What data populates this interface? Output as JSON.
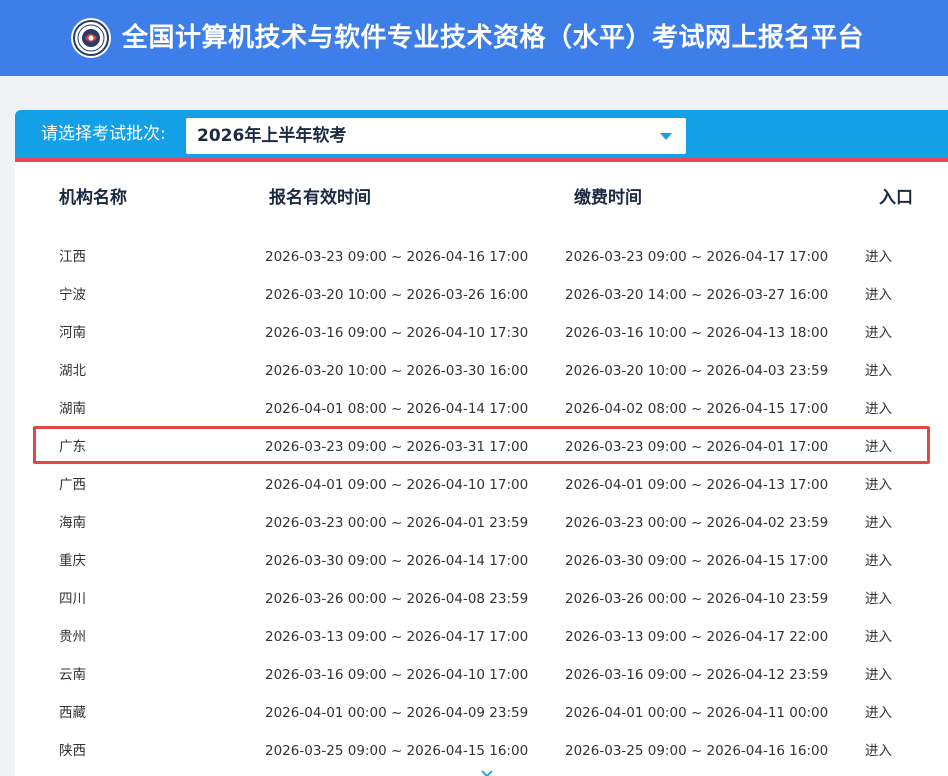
{
  "header": {
    "title": "全国计算机技术与软件专业技术资格（水平）考试网上报名平台"
  },
  "batch": {
    "label": "请选择考试批次:",
    "selected": "2026年上半年软考"
  },
  "table": {
    "columns": [
      "机构名称",
      "报名有效时间",
      "缴费时间",
      "入口"
    ],
    "rows": [
      {
        "name": "江西",
        "reg": "2026-03-23 09:00 ~ 2026-04-16 17:00",
        "pay": "2026-03-23 09:00 ~ 2026-04-17 17:00",
        "entry": "进入"
      },
      {
        "name": "宁波",
        "reg": "2026-03-20 10:00 ~ 2026-03-26 16:00",
        "pay": "2026-03-20 14:00 ~ 2026-03-27 16:00",
        "entry": "进入"
      },
      {
        "name": "河南",
        "reg": "2026-03-16 09:00 ~ 2026-04-10 17:30",
        "pay": "2026-03-16 10:00 ~ 2026-04-13 18:00",
        "entry": "进入"
      },
      {
        "name": "湖北",
        "reg": "2026-03-20 10:00 ~ 2026-03-30 16:00",
        "pay": "2026-03-20 10:00 ~ 2026-04-03 23:59",
        "entry": "进入"
      },
      {
        "name": "湖南",
        "reg": "2026-04-01 08:00 ~ 2026-04-14 17:00",
        "pay": "2026-04-02 08:00 ~ 2026-04-15 17:00",
        "entry": "进入"
      },
      {
        "name": "广东",
        "reg": "2026-03-23 09:00 ~ 2026-03-31 17:00",
        "pay": "2026-03-23 09:00 ~ 2026-04-01 17:00",
        "entry": "进入"
      },
      {
        "name": "广西",
        "reg": "2026-04-01 09:00 ~ 2026-04-10 17:00",
        "pay": "2026-04-01 09:00 ~ 2026-04-13 17:00",
        "entry": "进入"
      },
      {
        "name": "海南",
        "reg": "2026-03-23 00:00 ~ 2026-04-01 23:59",
        "pay": "2026-03-23 00:00 ~ 2026-04-02 23:59",
        "entry": "进入"
      },
      {
        "name": "重庆",
        "reg": "2026-03-30 09:00 ~ 2026-04-14 17:00",
        "pay": "2026-03-30 09:00 ~ 2026-04-15 17:00",
        "entry": "进入"
      },
      {
        "name": "四川",
        "reg": "2026-03-26 00:00 ~ 2026-04-08 23:59",
        "pay": "2026-03-26 00:00 ~ 2026-04-10 23:59",
        "entry": "进入"
      },
      {
        "name": "贵州",
        "reg": "2026-03-13 09:00 ~ 2026-04-17 17:00",
        "pay": "2026-03-13 09:00 ~ 2026-04-17 22:00",
        "entry": "进入"
      },
      {
        "name": "云南",
        "reg": "2026-03-16 09:00 ~ 2026-04-10 17:00",
        "pay": "2026-03-16 09:00 ~ 2026-04-12 23:59",
        "entry": "进入"
      },
      {
        "name": "西藏",
        "reg": "2026-04-01 00:00 ~ 2026-04-09 23:59",
        "pay": "2026-04-01 00:00 ~ 2026-04-11 00:00",
        "entry": "进入"
      },
      {
        "name": "陕西",
        "reg": "2026-03-25 09:00 ~ 2026-04-15 16:00",
        "pay": "2026-03-25 09:00 ~ 2026-04-16 16:00",
        "entry": "进入"
      }
    ]
  },
  "colors": {
    "header_bg": "#3d7ee8",
    "batch_bar": "#13a0e6",
    "batch_underline": "#e8475b",
    "highlight_border": "#e04848",
    "scroll_hint": "#13a0e6"
  },
  "icons": {
    "logo": "emblem-logo-icon",
    "select_arrow": "caret-down-icon",
    "scroll_hint": "chevron-down-icon"
  }
}
